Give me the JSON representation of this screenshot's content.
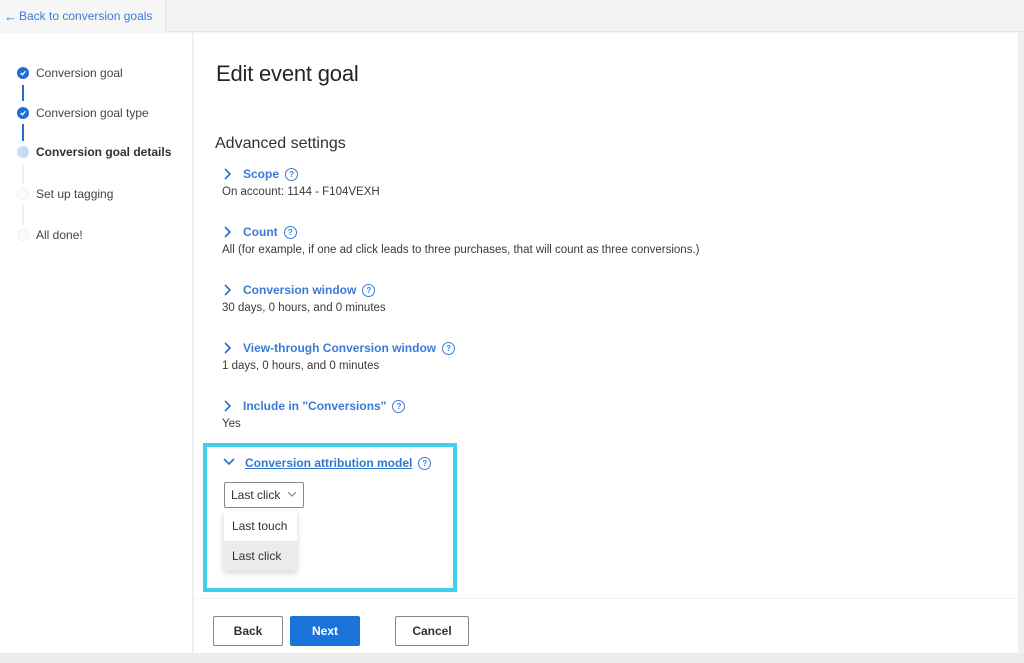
{
  "topbar": {
    "back_link": "Back to conversion goals",
    "back_icon": "arrow-left-icon"
  },
  "wizard": {
    "steps": [
      {
        "label": "Conversion goal",
        "state": "done"
      },
      {
        "label": "Conversion goal type",
        "state": "done"
      },
      {
        "label": "Conversion goal details",
        "state": "current"
      },
      {
        "label": "Set up tagging",
        "state": "todo"
      },
      {
        "label": "All done!",
        "state": "todo"
      }
    ]
  },
  "main": {
    "title": "Edit event goal",
    "section_title": "Advanced settings",
    "settings": [
      {
        "name": "Scope",
        "value": "On account: 1144 - F104VEXH",
        "expanded": false
      },
      {
        "name": "Count",
        "value": "All (for example, if one ad click leads to three purchases, that will count as three conversions.)",
        "expanded": false
      },
      {
        "name": "Conversion window",
        "value": "30 days, 0 hours, and 0 minutes",
        "expanded": false
      },
      {
        "name": "View-through Conversion window",
        "value": "1 days, 0 hours, and 0 minutes",
        "expanded": false
      },
      {
        "name": "Include in \"Conversions\"",
        "value": "Yes",
        "expanded": false
      },
      {
        "name": "Conversion attribution model",
        "value": "",
        "expanded": true
      }
    ],
    "help_glyph": "?",
    "attribution": {
      "selected": "Last click",
      "options": [
        "Last touch",
        "Last click"
      ],
      "highlighted_option": "Last click"
    }
  },
  "footer": {
    "back_label": "Back",
    "next_label": "Next",
    "cancel_label": "Cancel"
  },
  "colors": {
    "accent": "#1a73d9",
    "link": "#3a7bd5",
    "highlight_border": "#3fd0f0",
    "step_done": "#1f6fd1",
    "step_current": "#c7dcf3"
  }
}
